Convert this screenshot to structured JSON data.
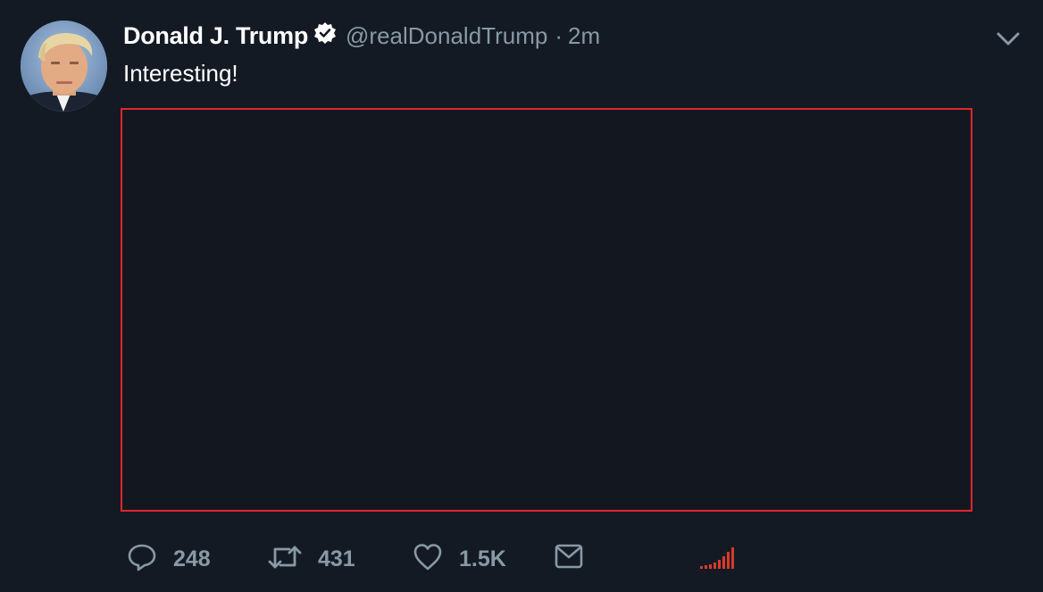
{
  "tweet": {
    "display_name": "Donald J. Trump",
    "handle": "@realDonaldTrump",
    "separator": "·",
    "time": "2m",
    "text": "Interesting!"
  },
  "actions": {
    "reply_count": "248",
    "retweet_count": "431",
    "like_count": "1.5K"
  },
  "colors": {
    "background": "#141a23",
    "secondary_text": "#8899a6",
    "media_border": "#e0262d",
    "analytics": "#d93a2b"
  },
  "icons": [
    "verified-badge-icon",
    "chevron-down-icon",
    "reply-icon",
    "retweet-icon",
    "like-icon",
    "direct-message-icon",
    "analytics-icon"
  ]
}
